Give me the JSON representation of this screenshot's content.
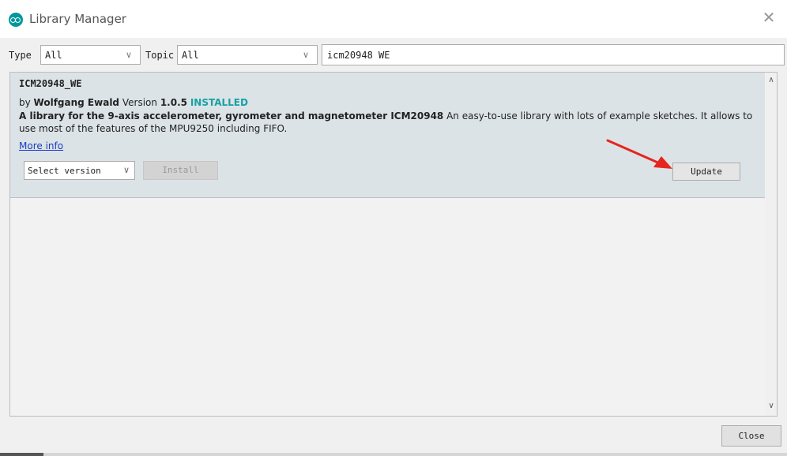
{
  "window": {
    "title": "Library Manager",
    "close_glyph": "✕"
  },
  "filters": {
    "type_label": "Type",
    "type_value": "All",
    "topic_label": "Topic",
    "topic_value": "All",
    "search_value": "icm20948 WE"
  },
  "library": {
    "name": "ICM20948_WE",
    "by_prefix": "by",
    "author": "Wolfgang Ewald",
    "version_prefix": "Version",
    "version": "1.0.5",
    "status": "INSTALLED",
    "sentence_bold": "A library for the 9-axis accelerometer, gyrometer and magnetometer ICM20948",
    "sentence_rest": " An easy-to-use library with lots of example sketches. It allows to use most of the features of the MPU9250 including FIFO.",
    "more_info": "More info",
    "select_version": "Select version",
    "install_label": "Install",
    "update_label": "Update"
  },
  "footer": {
    "close_label": "Close"
  },
  "colors": {
    "accent": "#00979c",
    "installed": "#17a1a5",
    "arrow": "#e5261f",
    "link": "#1a3cc8"
  }
}
